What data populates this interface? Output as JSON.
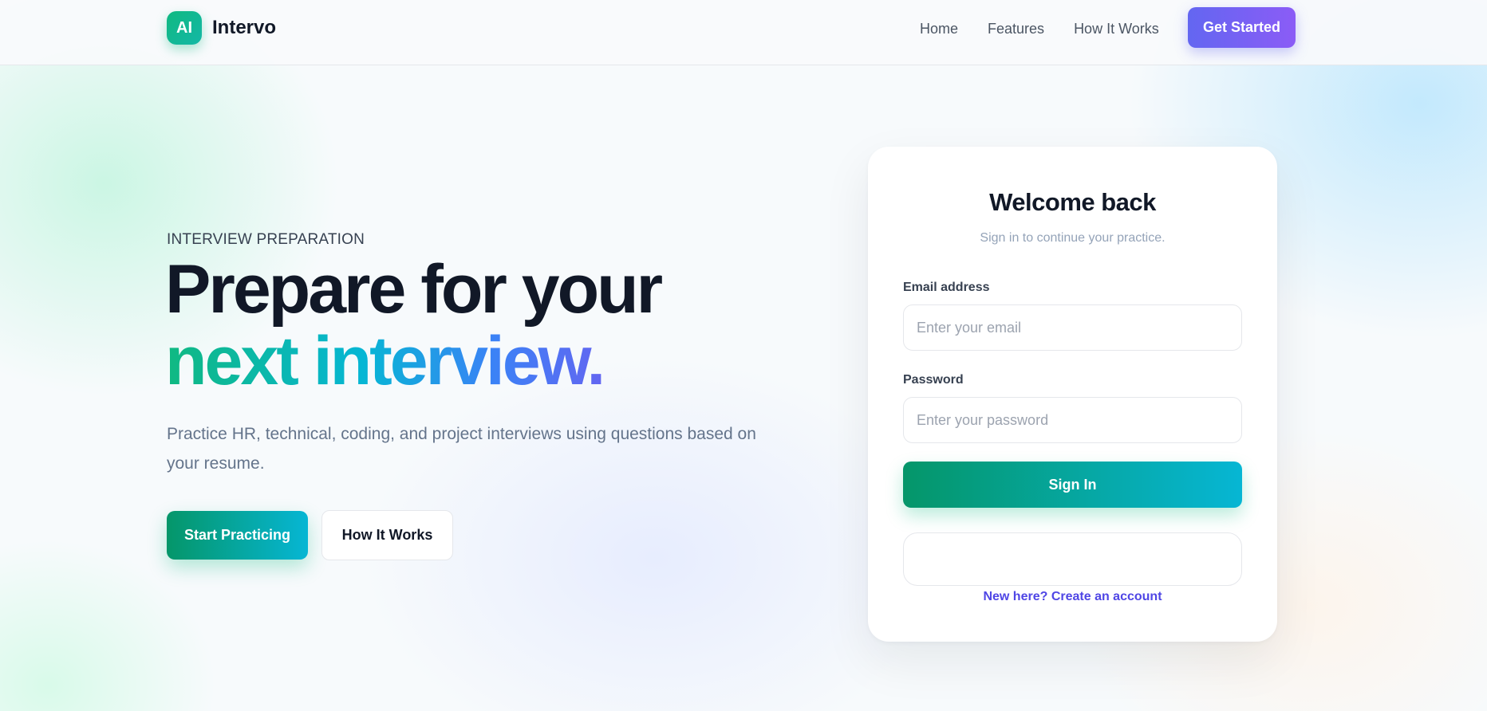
{
  "nav": {
    "logo_text": "AI",
    "brand_name": "Intervo",
    "links": [
      "Home",
      "Features",
      "How It Works"
    ],
    "cta_label": "Get Started"
  },
  "hero": {
    "eyebrow": "INTERVIEW PREPARATION",
    "headline_line1": "Prepare for your",
    "headline_line2": "next interview.",
    "description": "Practice HR, technical, coding, and project interviews using questions based on your resume.",
    "primary_button": "Start Practicing",
    "secondary_button": "How It Works"
  },
  "login": {
    "title": "Welcome back",
    "subtitle": "Sign in to continue your practice.",
    "email_label": "Email address",
    "email_placeholder": "Enter your email",
    "password_label": "Password",
    "password_placeholder": "Enter your password",
    "signin_button": "Sign In",
    "create_account_link": "New here? Create an account"
  },
  "colors": {
    "accent_green": "#059669",
    "accent_cyan": "#06b6d4",
    "accent_indigo": "#6366f1",
    "link_color": "#4f46e5"
  }
}
